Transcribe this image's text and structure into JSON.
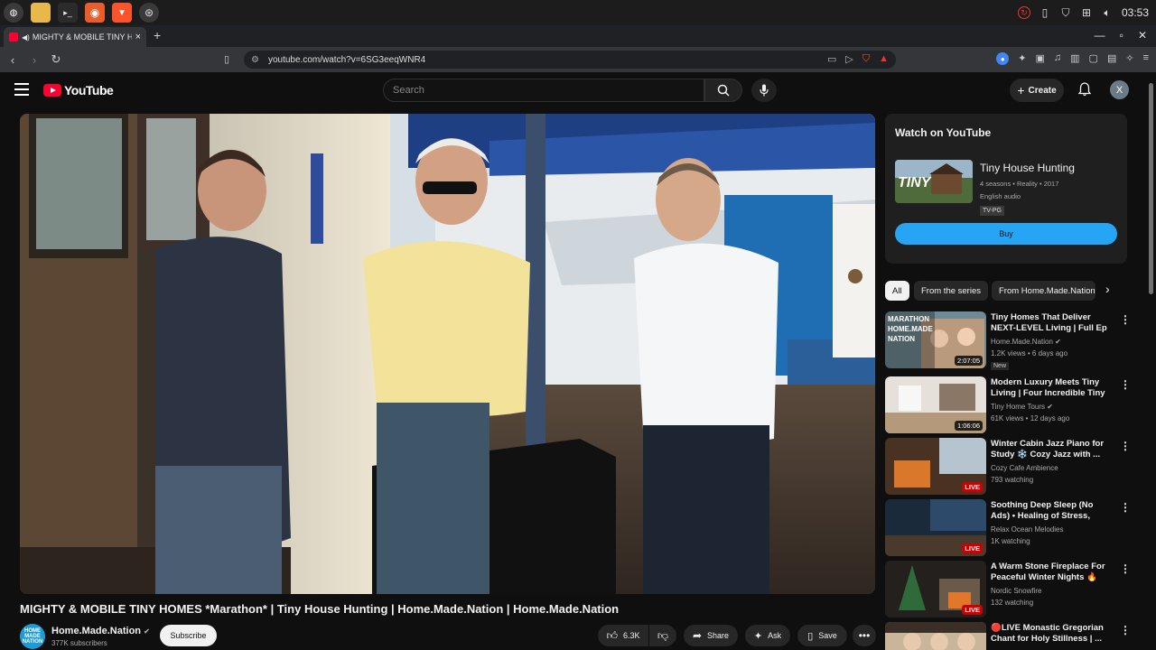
{
  "os": {
    "clock": "03:53",
    "apps": [
      "mint-menu-icon",
      "files-icon",
      "terminal-icon",
      "firefox-icon",
      "brave-icon",
      "chromium-icon"
    ]
  },
  "browser": {
    "tab_title": "MIGHTY & MOBILE TINY HOMES *Marathon* | Tiny House Hunting | Home.Made.Nation",
    "url": "youtube.com/watch?v=6SG3eeqWNR4",
    "accent": "#ff0033"
  },
  "yt": {
    "logo": "YouTube",
    "search_placeholder": "Search",
    "create": "Create",
    "avatar_letter": "X"
  },
  "video": {
    "title": "MIGHTY & MOBILE TINY HOMES *Marathon* | Tiny House Hunting | Home.Made.Nation | Home.Made.Nation",
    "channel": "Home.Made.Nation",
    "channel_badge": "HOME MADE NATION",
    "subscribers": "377K subscribers",
    "subscribe": "Subscribe",
    "likes": "6.3K",
    "share": "Share",
    "ask": "Ask",
    "save": "Save"
  },
  "watch_card": {
    "heading": "Watch on YouTube",
    "show": "Tiny House Hunting",
    "thumb_text": "TINY",
    "meta1": "4 seasons • Reality • 2017",
    "meta2": "English audio",
    "rating": "TV-PG",
    "buy": "Buy"
  },
  "chips": [
    "All",
    "From the series",
    "From Home.Made.Nation"
  ],
  "recommended": [
    {
      "title": "Tiny Homes That Deliver NEXT-LEVEL Living | Full Ep ...",
      "channel": "Home.Made.Nation",
      "verified": true,
      "views": "1.2K views • 6 days ago",
      "badge": "2:07:05",
      "live": false,
      "new": "New",
      "thumb_overlay": "MARATHON HOME.MADE NATION"
    },
    {
      "title": "Modern Luxury Meets Tiny Living | Four Incredible Tiny ...",
      "channel": "Tiny Home Tours",
      "verified": true,
      "views": "61K views • 12 days ago",
      "badge": "1:06:06",
      "live": false,
      "new": "",
      "thumb_overlay": ""
    },
    {
      "title": "Winter Cabin Jazz Piano for Study ❄️ Cozy Jazz with ...",
      "channel": "Cozy Cafe Ambience",
      "verified": false,
      "views": "793 watching",
      "badge": "LIVE",
      "live": true,
      "new": "",
      "thumb_overlay": ""
    },
    {
      "title": "Soothing Deep Sleep (No Ads) • Healing of Stress, Anxiety and ...",
      "channel": "Relax Ocean Melodies",
      "verified": false,
      "views": "1K watching",
      "badge": "LIVE",
      "live": true,
      "new": "",
      "thumb_overlay": ""
    },
    {
      "title": "A Warm Stone Fireplace For Peaceful Winter Nights 🔥Win...",
      "channel": "Nordic Snowfire",
      "verified": false,
      "views": "132 watching",
      "badge": "LIVE",
      "live": true,
      "new": "",
      "thumb_overlay": ""
    },
    {
      "title": "🔴LIVE Monastic Gregorian Chant for Holy Stillness | ...",
      "channel": "",
      "verified": false,
      "views": "",
      "badge": "",
      "live": false,
      "new": "",
      "thumb_overlay": ""
    }
  ]
}
